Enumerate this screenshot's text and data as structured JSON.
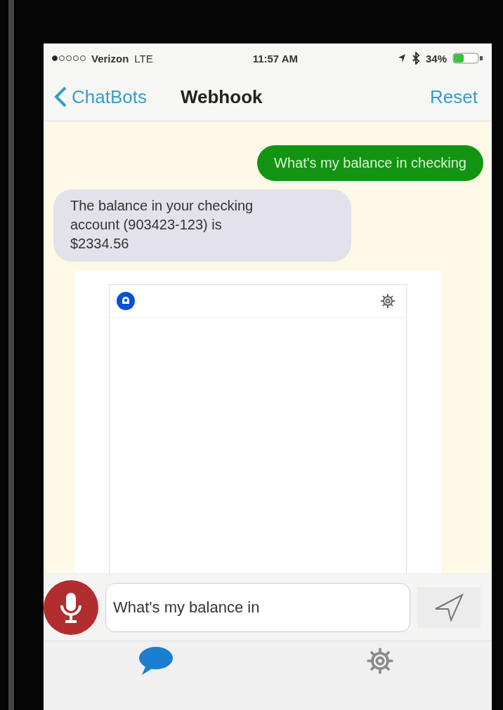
{
  "status_bar": {
    "carrier": "Verizon",
    "network": "LTE",
    "time": "11:57 AM",
    "battery": "34%"
  },
  "nav": {
    "back": "ChatBots",
    "title": "Webhook",
    "action": "Reset"
  },
  "messages": [
    {
      "kind": "sent",
      "text": "What's my balance in checking"
    },
    {
      "kind": "received",
      "text": "The balance in your checking account (903423-123) is $2334.56"
    },
    {
      "kind": "webview"
    }
  ],
  "composer": {
    "value": "What's my balance in"
  },
  "tabs": [
    {
      "kind": "chat",
      "selected": true
    },
    {
      "kind": "settings",
      "selected": false
    }
  ]
}
